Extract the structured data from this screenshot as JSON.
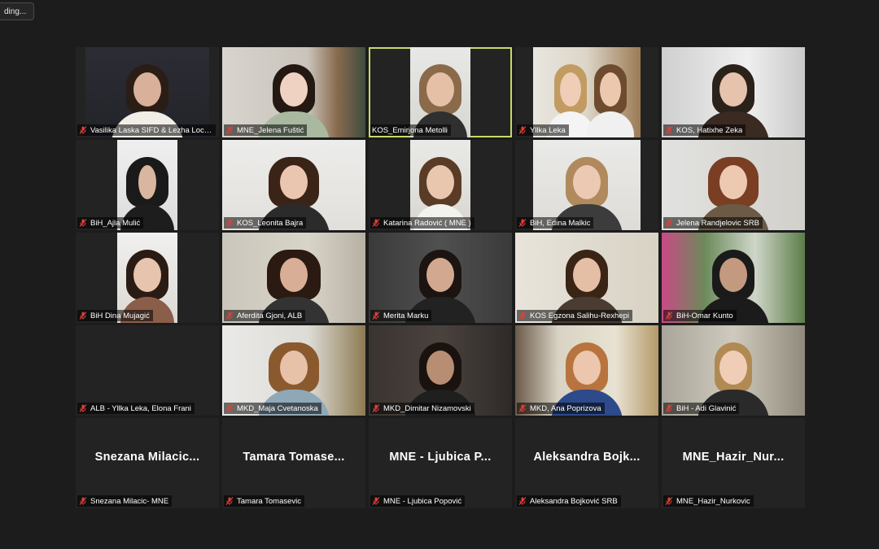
{
  "recording_label": "ding...",
  "colors": {
    "active_speaker": "#c8d96a",
    "muted_icon": "#e0403a",
    "background": "#1c1c1c"
  },
  "participants": [
    {
      "name": "Vasilika Laska SIFD & Lezha Local ...",
      "muted": true
    },
    {
      "name": "MNE_Jelena Fuštić",
      "muted": true
    },
    {
      "name": "KOS_Emirjona Metolli",
      "muted": false,
      "active": true
    },
    {
      "name": "Yllka Leka",
      "muted": true
    },
    {
      "name": "KOS, Hatixhe Zeka",
      "muted": true
    },
    {
      "name": "BiH_Ajla Mulić",
      "muted": true
    },
    {
      "name": "KOS_Leonita Bajra",
      "muted": true
    },
    {
      "name": "Katarina Radović ( MNE )",
      "muted": true
    },
    {
      "name": "BiH, Edina Malkic",
      "muted": true
    },
    {
      "name": "Jelena Randjelovic SRB",
      "muted": true
    },
    {
      "name": "BiH Dina Mujagić",
      "muted": true
    },
    {
      "name": "Aferdita Gjoni, ALB",
      "muted": true
    },
    {
      "name": "Merita Marku",
      "muted": true
    },
    {
      "name": "KOS Egzona Salihu-Rexhepi",
      "muted": true
    },
    {
      "name": "BiH-Omar Kunto",
      "muted": true
    },
    {
      "name": "ALB - Yllka Leka, Elona Frani",
      "muted": true
    },
    {
      "name": "MKD_Maja Cvetanoska",
      "muted": true
    },
    {
      "name": "MKD_Dimitar Nizamovski",
      "muted": true
    },
    {
      "name": "MKD, Ana Poprizova",
      "muted": true
    },
    {
      "name": "BiH - Adi Glavinić",
      "muted": true
    },
    {
      "name": "Snezana Milacic- MNE",
      "display_name": "Snezana  Milacic...",
      "muted": true
    },
    {
      "name": "Tamara Tomasevic",
      "display_name": "Tamara  Tomase...",
      "muted": true
    },
    {
      "name": "MNE - Ljubica Popović",
      "display_name": "MNE - Ljubica P...",
      "muted": true
    },
    {
      "name": "Aleksandra Bojković SRB",
      "display_name": "Aleksandra  Bojk...",
      "muted": true
    },
    {
      "name": "MNE_Hazir_Nurkovic",
      "display_name": "MNE_Hazir_Nur...",
      "muted": true
    }
  ]
}
